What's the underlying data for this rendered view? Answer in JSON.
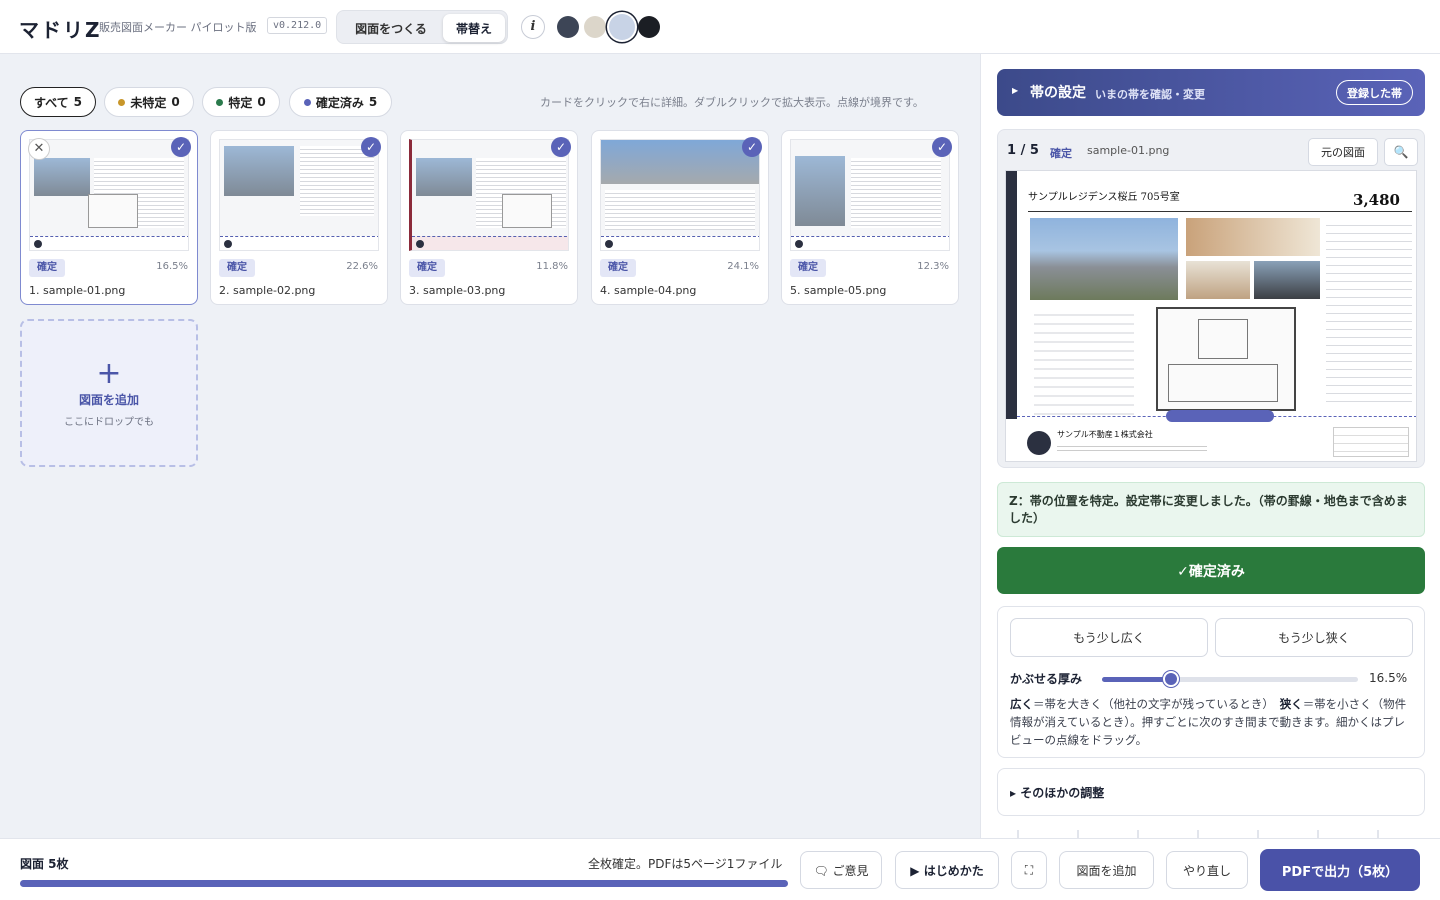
{
  "header": {
    "logo": "マドリZ",
    "subtitle": "販売図面メーカー パイロット版",
    "version": "v0.212.0",
    "mode_make": "図面をつくる",
    "mode_replace": "帯替え",
    "info": "i",
    "swatches": [
      "#3d4556",
      "#dcd6ca",
      "#c8d3e6",
      "#1b1e24"
    ]
  },
  "filters": [
    {
      "label": "すべて",
      "count": "5"
    },
    {
      "label": "未特定",
      "count": "0",
      "color": "#c8962a"
    },
    {
      "label": "特定",
      "count": "0",
      "color": "#2a7a4c"
    },
    {
      "label": "確定済み",
      "count": "5",
      "color": "#5a63b8"
    }
  ],
  "hint": "カードをクリックで右に詳細。ダブルクリックで拡大表示。点線が境界です。",
  "cards": [
    {
      "status": "確定",
      "pct": "16.5%",
      "name": "1. sample-01.png"
    },
    {
      "status": "確定",
      "pct": "22.6%",
      "name": "2. sample-02.png"
    },
    {
      "status": "確定",
      "pct": "11.8%",
      "name": "3. sample-03.png"
    },
    {
      "status": "確定",
      "pct": "24.1%",
      "name": "4. sample-04.png"
    },
    {
      "status": "確定",
      "pct": "12.3%",
      "name": "5. sample-05.png"
    }
  ],
  "add_card": {
    "label": "図面を追加",
    "sub": "ここにドロップでも"
  },
  "panel": {
    "obi_title": "帯の設定",
    "obi_sub": "いまの帯を確認・変更",
    "registered_btn": "登録した帯",
    "count": "1 / 5",
    "status": "確定",
    "file": "sample-01.png",
    "orig_btn": "元の図面",
    "flyer": {
      "heading": "サンプルレジデンス桜丘 705号室",
      "price": "3,480",
      "company": "サンプル不動産１株式会社"
    },
    "message": "Z：帯の位置を特定。設定帯に変更しました。（帯の罫線・地色まで含めました）",
    "confirm_btn": "✓確定済み",
    "wider_btn": "もう少し広く",
    "narrower_btn": "もう少し狭く",
    "slider_label": "かぶせる厚み",
    "slider_value": "16.5%",
    "slider_fraction": 0.165,
    "desc_wide": "広く",
    "desc_wide_text": "＝帯を大きく（他社の文字が残っているとき）",
    "desc_narrow": "狭く",
    "desc_narrow_text": "＝帯を小さく（物件情報が消えているとき）。押すごとに次のすき間まで動きます。細かくはプレビューの点線をドラッグ。",
    "other_adjust": "▸ そのほかの調整"
  },
  "footer": {
    "count": "図面 5枚",
    "status": "全枚確定。PDFは5ページ1ファイル",
    "progress": 1.0,
    "feedback": "ご意見",
    "howto": "▶ はじめかた",
    "fullscreen": "⛶",
    "add": "図面を追加",
    "redo": "やり直し",
    "pdf": "PDFで出力（5枚）"
  }
}
